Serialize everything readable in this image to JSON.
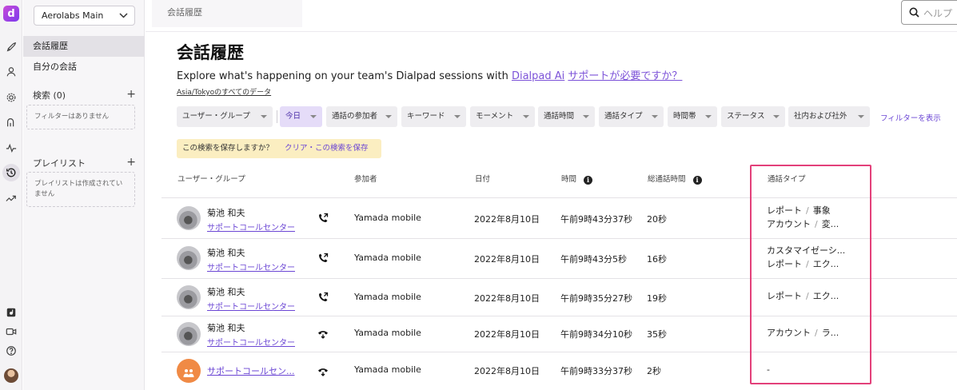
{
  "workspace": {
    "name": "Aerolabs Main"
  },
  "sidebar": {
    "nav": [
      {
        "label": "会話履歴",
        "active": true
      },
      {
        "label": "自分の会話",
        "active": false
      }
    ],
    "search_section": {
      "label": "検索 (0)",
      "empty": "フィルターはありません"
    },
    "playlist_section": {
      "label": "プレイリスト",
      "empty": "プレイリストは作成されていません"
    }
  },
  "header": {
    "breadcrumb": "会話履歴",
    "search_placeholder": "ヘルプ"
  },
  "main": {
    "title": "会話履歴",
    "subtitle_text": "Explore what's happening on your team's Dialpad sessions with ",
    "subtitle_link": "Dialpad Ai",
    "help_link": "サポートが必要ですか？",
    "timezone": "Asia/Tokyoのすべてのデータ"
  },
  "filters": [
    {
      "label": "ユーザー・グループ",
      "selected": false
    },
    {
      "label": "今日",
      "selected": true
    },
    {
      "label": "通話の参加者",
      "selected": false
    },
    {
      "label": "キーワード",
      "selected": false
    },
    {
      "label": "モーメント",
      "selected": false
    },
    {
      "label": "通話時間",
      "selected": false
    },
    {
      "label": "通話タイプ",
      "selected": false
    },
    {
      "label": "時間帯",
      "selected": false
    },
    {
      "label": "ステータス",
      "selected": false
    },
    {
      "label": "社内および社外",
      "selected": false
    }
  ],
  "show_filters": "フィルターを表示",
  "save_search": {
    "prompt": "この検索を保存しますか？",
    "action": "クリア・この検索を保存"
  },
  "table": {
    "headers": [
      "ユーザー・グループ",
      "参加者",
      "日付",
      "時間",
      "総通話時間",
      "通話タイプ"
    ],
    "rows": [
      {
        "user": "菊池 和夫",
        "group": "サポートコールセンター",
        "direction": "outgoing",
        "participant": "Yamada mobile",
        "date": "2022年8月10日",
        "time": "午前9時43分37秒",
        "duration": "20秒",
        "types": [
          [
            "レポート",
            "事象"
          ],
          [
            "アカウント",
            "変..."
          ]
        ]
      },
      {
        "user": "菊池 和夫",
        "group": "サポートコールセンター",
        "direction": "outgoing",
        "participant": "Yamada mobile",
        "date": "2022年8月10日",
        "time": "午前9時43分5秒",
        "duration": "16秒",
        "types": [
          [
            "カスタマイゼーシ..."
          ],
          [
            "レポート",
            "エク..."
          ]
        ]
      },
      {
        "user": "菊池 和夫",
        "group": "サポートコールセンター",
        "direction": "outgoing",
        "participant": "Yamada mobile",
        "date": "2022年8月10日",
        "time": "午前9時35分27秒",
        "duration": "19秒",
        "types": [
          [
            "レポート",
            "エク..."
          ]
        ]
      },
      {
        "user": "菊池 和夫",
        "group": "サポートコールセンター",
        "direction": "missed",
        "participant": "Yamada mobile",
        "date": "2022年8月10日",
        "time": "午前9時34分10秒",
        "duration": "35秒",
        "types": [
          [
            "アカウント",
            "ラ..."
          ]
        ]
      },
      {
        "user": "",
        "group": "サポートコールセン...",
        "direction": "missed",
        "participant": "Yamada mobile",
        "date": "2022年8月10日",
        "time": "午前9時33分37秒",
        "duration": "2秒",
        "types": [
          [
            "-"
          ]
        ]
      }
    ]
  },
  "colors": {
    "accent": "#6b46d4",
    "highlight": "#e3407a",
    "save_bar": "#fbeec1"
  }
}
